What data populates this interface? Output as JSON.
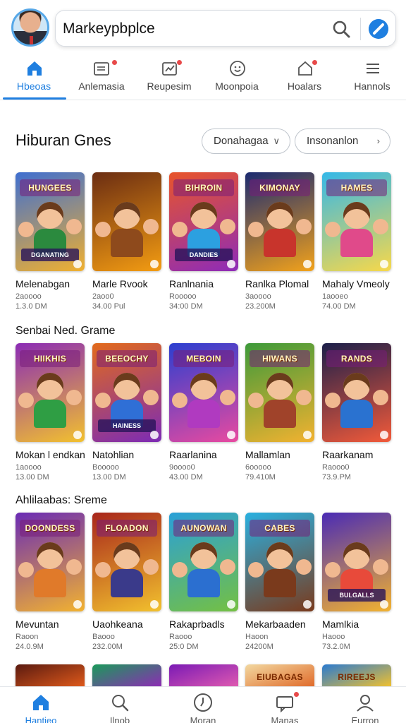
{
  "header": {
    "search_text": "Markeypbplce"
  },
  "tabs": [
    {
      "label": "Hbeoas",
      "icon": "home-icon",
      "active": true
    },
    {
      "label": "Anlemasia",
      "icon": "news-icon",
      "badge": true
    },
    {
      "label": "Reupesim",
      "icon": "trending-icon",
      "badge": true
    },
    {
      "label": "Moonpoia",
      "icon": "smiley-icon"
    },
    {
      "label": "Hoalars",
      "icon": "house-badge-icon",
      "badge": true
    },
    {
      "label": "Hannols",
      "icon": "menu-icon"
    }
  ],
  "section1": {
    "title": "Hiburan Gnes",
    "filter1": "Donahagaa",
    "filter2": "Insonanlon",
    "cards": [
      {
        "name": "Melenabgan",
        "meta1": "2aoooo",
        "meta2": "1.3.0 DM",
        "banner": "HUNGEES",
        "lower": "DGANATING",
        "c1": "#3f6fd0",
        "c2": "#f0b030",
        "body": "#2b8a3e"
      },
      {
        "name": "Marle Rvook",
        "meta1": "2aoo0",
        "meta2": "34.00 Pul",
        "banner": "",
        "lower": "",
        "c1": "#6b2d12",
        "c2": "#f39c12",
        "body": "#8e4a1c"
      },
      {
        "name": "Ranlnania",
        "meta1": "Rooooo",
        "meta2": "34:00 DM",
        "banner": "BIHROIN",
        "lower": "DANDIES",
        "c1": "#e8552a",
        "c2": "#8e2bb8",
        "body": "#2ca0e0"
      },
      {
        "name": "Ranlka Plomal",
        "meta1": "3aoooo",
        "meta2": "23.200M",
        "banner": "KIMONAY",
        "lower": "",
        "c1": "#1a2a70",
        "c2": "#f2a21b",
        "body": "#c8342c"
      },
      {
        "name": "Mahaly Vmeoly",
        "meta1": "1aooeo",
        "meta2": "74.00 DM",
        "banner": "HAMES",
        "lower": "",
        "c1": "#34b8e8",
        "c2": "#f7d84a",
        "body": "#e04a8a"
      }
    ]
  },
  "section2": {
    "title": "Senbai Ned. Grame",
    "cards": [
      {
        "name": "Mokan l endkan",
        "meta1": "1aoooo",
        "meta2": "13.00 DM",
        "banner": "HIIKHIS",
        "lower": "",
        "c1": "#8b2bb5",
        "c2": "#f2c12e",
        "body": "#2f9e44"
      },
      {
        "name": "Natohlian",
        "meta1": "Booooo",
        "meta2": "13.00 DM",
        "banner": "BEEOCHY",
        "lower": "HAINESS",
        "c1": "#e26a1b",
        "c2": "#7c2bb5",
        "body": "#2f6fd6"
      },
      {
        "name": "Raarlanina",
        "meta1": "9oooo0",
        "meta2": "43.00 DM",
        "banner": "MEBOIN",
        "lower": "",
        "c1": "#2b3fd0",
        "c2": "#e84aa0",
        "body": "#b03ac0"
      },
      {
        "name": "Mallamlan",
        "meta1": "6ooooo",
        "meta2": "79.410M",
        "banner": "HIWANS",
        "lower": "",
        "c1": "#3d9a3a",
        "c2": "#f2b230",
        "body": "#a0432a"
      },
      {
        "name": "Raarkanam",
        "meta1": "Raooo0",
        "meta2": "73.9.PM",
        "banner": "RANDS",
        "lower": "",
        "c1": "#1b1f4a",
        "c2": "#f25a3a",
        "body": "#2a72d0"
      }
    ]
  },
  "section3": {
    "title": "Ahlilaabas: Sreme",
    "cards": [
      {
        "name": "Mevuntan",
        "meta1": "Raoon",
        "meta2": "24.0.9M",
        "banner": "DOONDESS",
        "lower": "",
        "c1": "#6a2bb5",
        "c2": "#f2b230",
        "body": "#e07a2a"
      },
      {
        "name": "Uaohkeana",
        "meta1": "Baooo",
        "meta2": "232.00M",
        "banner": "FLOADON",
        "lower": "",
        "c1": "#a8261b",
        "c2": "#f2c12e",
        "body": "#3a3a8a"
      },
      {
        "name": "Rakaprbadls",
        "meta1": "Raooo",
        "meta2": "25:0 DM",
        "banner": "AUNOWAN",
        "lower": "",
        "c1": "#2aa0d8",
        "c2": "#74c043",
        "body": "#2b6fd0"
      },
      {
        "name": "Mekarbaaden",
        "meta1": "Haoon",
        "meta2": "24200M",
        "banner": "CABES",
        "lower": "",
        "c1": "#2ab0e0",
        "c2": "#7a3a1c",
        "body": "#7a3a1c"
      },
      {
        "name": "Mamlkia",
        "meta1": "Haooo",
        "meta2": "73.2.0M",
        "banner": "",
        "lower": "BULGALLS",
        "c1": "#4a2bb5",
        "c2": "#f2b230",
        "body": "#e84a3a"
      }
    ]
  },
  "section4": {
    "cards": [
      {
        "c1": "#5a1a10",
        "c2": "#e05a1b"
      },
      {
        "c1": "#1a9a5a",
        "c2": "#8e2bb5"
      },
      {
        "c1": "#7a1ab5",
        "c2": "#e05ab0"
      },
      {
        "c1": "#f2d8a0",
        "c2": "#e06a2a",
        "banner": "EIUBAGAS"
      },
      {
        "c1": "#2a7ad0",
        "c2": "#f2c12e",
        "banner": "RIREEJS"
      }
    ]
  },
  "bottom_nav": [
    {
      "label": "Hantieo",
      "icon": "home-icon",
      "active": true
    },
    {
      "label": "Ilnob",
      "icon": "search-icon"
    },
    {
      "label": "Moran",
      "icon": "clock-icon"
    },
    {
      "label": "Manas",
      "icon": "chat-icon",
      "badge": true
    },
    {
      "label": "Eurron",
      "icon": "profile-icon"
    }
  ],
  "colors": {
    "accent": "#1f7fe0",
    "badge": "#e84a4a"
  }
}
